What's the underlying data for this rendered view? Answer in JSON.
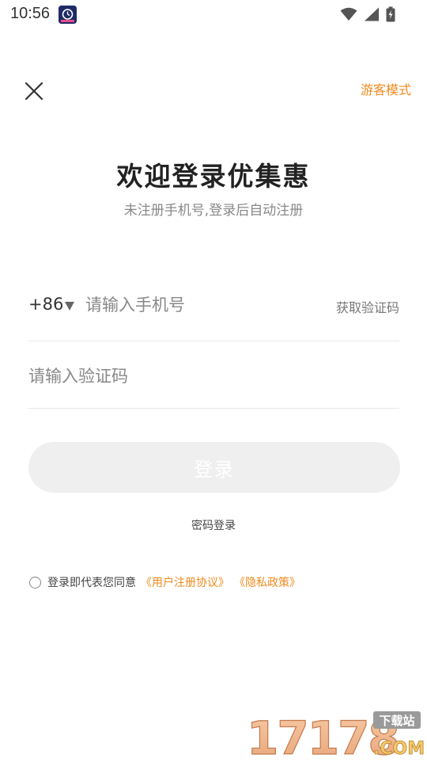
{
  "status_bar": {
    "time": "10:56",
    "app_icon": "app-notification-icon",
    "icons": [
      "wifi-icon",
      "signal-icon",
      "battery-charging-icon"
    ]
  },
  "header": {
    "close_icon": "close-icon",
    "guest_mode_label": "游客模式"
  },
  "title": "欢迎登录优集惠",
  "subtitle": "未注册手机号,登录后自动注册",
  "phone": {
    "country_code": "+86",
    "dropdown_icon": "triangle-down-icon",
    "placeholder": "请输入手机号",
    "value": "",
    "get_code_label": "获取验证码"
  },
  "code": {
    "placeholder": "请输入验证码",
    "value": ""
  },
  "login_button_label": "登录",
  "password_login_label": "密码登录",
  "agreement": {
    "checked": false,
    "prefix": "登录即代表您同意",
    "user_agreement": "《用户注册协议》",
    "privacy_policy": "《隐私政策》"
  },
  "watermark": {
    "number": "17178",
    "tag": "下载站",
    "suffix": ".COM"
  },
  "colors": {
    "accent": "#f08a1c",
    "button_bg": "#efefef",
    "divider": "#e8e8e8"
  }
}
